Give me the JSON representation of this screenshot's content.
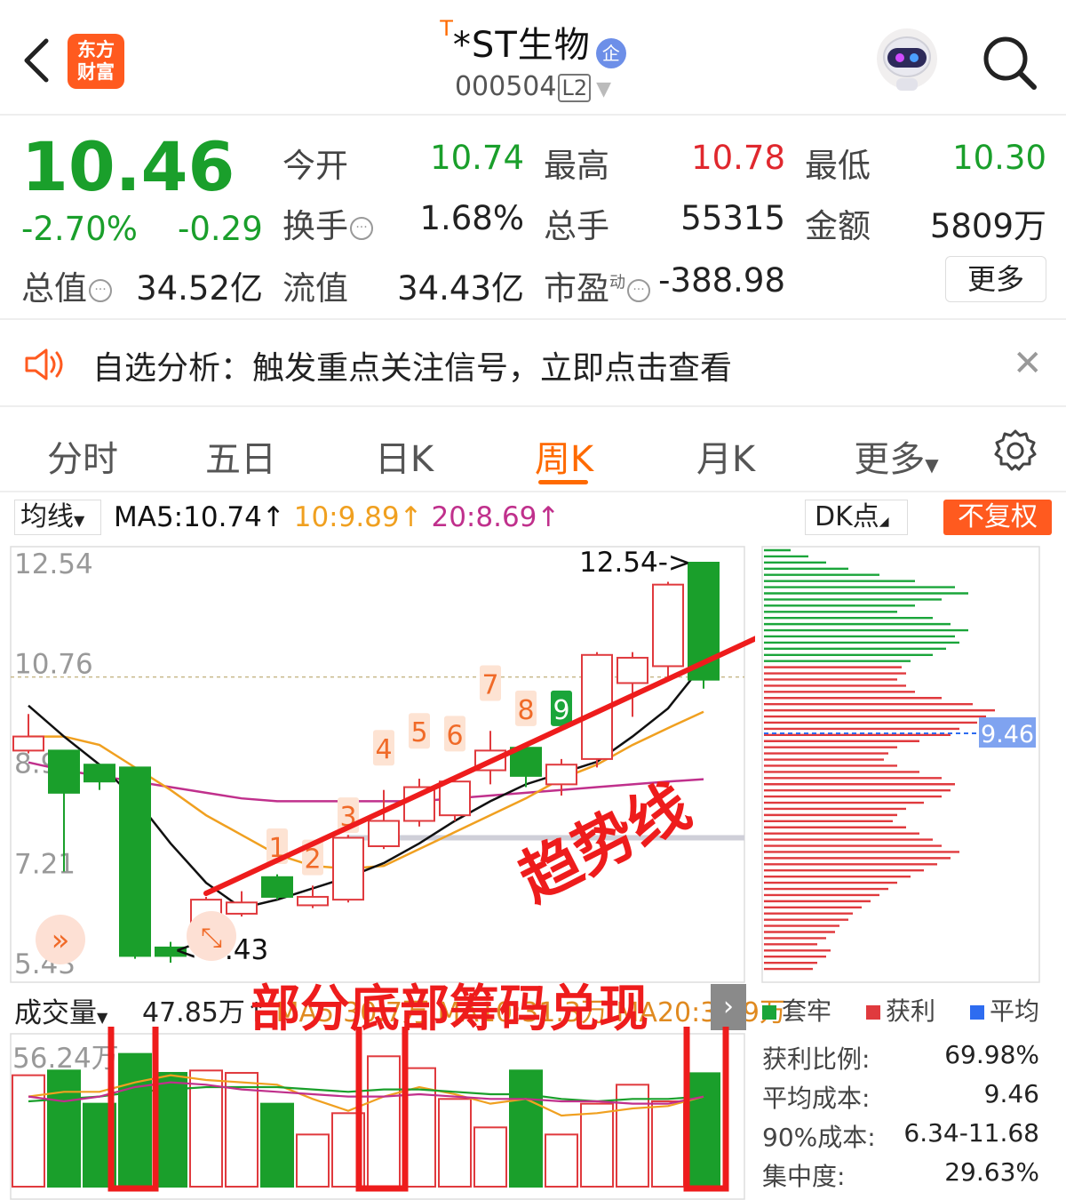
{
  "header": {
    "title": "*ST生物",
    "title_sup": "T",
    "badge": "企",
    "code": "000504",
    "level": "L2",
    "logo_line1": "东方",
    "logo_line2": "财富"
  },
  "quote": {
    "price": "10.46",
    "change_pct": "-2.70%",
    "change": "-0.29",
    "open_label": "今开",
    "open": "10.74",
    "high_label": "最高",
    "high": "10.78",
    "low_label": "最低",
    "low": "10.30",
    "turnover_label": "换手",
    "turnover": "1.68%",
    "volume_label": "总手",
    "volume": "55315",
    "amount_label": "金额",
    "amount": "5809万",
    "mktcap_label": "总值",
    "mktcap": "34.52亿",
    "float_label": "流值",
    "float": "34.43亿",
    "pe_label": "市盈",
    "pe_sup": "动",
    "pe": "-388.98",
    "more_label": "更多"
  },
  "notice": {
    "text": "自选分析：触发重点关注信号，立即点击查看"
  },
  "tabs": [
    "分时",
    "五日",
    "日K",
    "周K",
    "月K",
    "更多"
  ],
  "active_tab": "周K",
  "ma": {
    "selector": "均线",
    "ma5": "MA5:10.74",
    "ma10": "10:9.89",
    "ma20": "20:8.69",
    "colors": {
      "ma5": "#111111",
      "ma10": "#f0a020",
      "ma20": "#c0308c"
    }
  },
  "dk_selector": "DK点",
  "fq_button": "不复权",
  "chart_data": {
    "type": "candlestick",
    "y_ticks": [
      "12.54",
      "10.76",
      "8.99",
      "7.21",
      "5.43"
    ],
    "ylim": [
      5.43,
      12.54
    ],
    "high_marker": "12.54->",
    "low_marker": "<-5.43",
    "candles": [
      {
        "o": 9.2,
        "c": 9.45,
        "h": 9.85,
        "l": 9.15
      },
      {
        "o": 9.2,
        "c": 8.45,
        "h": 9.2,
        "l": 7.05
      },
      {
        "o": 8.95,
        "c": 8.65,
        "h": 8.95,
        "l": 8.5
      },
      {
        "o": 8.9,
        "c": 5.55,
        "h": 8.9,
        "l": 5.5
      },
      {
        "o": 5.7,
        "c": 5.55,
        "h": 5.8,
        "l": 5.43
      },
      {
        "o": 5.7,
        "c": 6.55,
        "h": 6.6,
        "l": 5.6
      },
      {
        "o": 6.3,
        "c": 6.5,
        "h": 6.7,
        "l": 6.25
      },
      {
        "o": 6.95,
        "c": 6.6,
        "h": 7.0,
        "l": 6.55
      },
      {
        "o": 6.45,
        "c": 6.6,
        "h": 6.8,
        "l": 6.4
      },
      {
        "o": 6.55,
        "c": 7.65,
        "h": 7.7,
        "l": 6.5
      },
      {
        "o": 7.5,
        "c": 7.95,
        "h": 8.5,
        "l": 7.45
      },
      {
        "o": 7.95,
        "c": 8.55,
        "h": 8.7,
        "l": 7.85
      },
      {
        "o": 8.05,
        "c": 8.65,
        "h": 8.75,
        "l": 7.95
      },
      {
        "o": 8.85,
        "c": 9.2,
        "h": 9.55,
        "l": 8.6
      },
      {
        "o": 9.25,
        "c": 8.75,
        "h": 9.3,
        "l": 8.55
      },
      {
        "o": 8.6,
        "c": 8.95,
        "h": 9.05,
        "l": 8.4
      },
      {
        "o": 9.05,
        "c": 10.9,
        "h": 10.95,
        "l": 8.9
      },
      {
        "o": 10.4,
        "c": 10.85,
        "h": 10.95,
        "l": 9.8
      },
      {
        "o": 10.7,
        "c": 12.15,
        "h": 12.2,
        "l": 10.5
      },
      {
        "o": 12.54,
        "c": 10.46,
        "h": 12.54,
        "l": 10.3
      }
    ],
    "ma5": [
      10.0,
      9.45,
      8.95,
      8.35,
      7.55,
      6.85,
      6.4,
      6.55,
      6.75,
      6.95,
      7.2,
      7.55,
      7.95,
      8.3,
      8.6,
      8.8,
      9.0,
      9.45,
      9.95,
      10.74
    ],
    "ma10": [
      9.45,
      9.45,
      9.3,
      8.9,
      8.5,
      8.05,
      7.7,
      7.35,
      7.15,
      7.1,
      7.15,
      7.45,
      7.75,
      8.05,
      8.35,
      8.7,
      8.95,
      9.3,
      9.6,
      9.89
    ],
    "ma20": [
      8.99,
      8.85,
      8.75,
      8.65,
      8.55,
      8.45,
      8.35,
      8.3,
      8.3,
      8.3,
      8.3,
      8.3,
      8.35,
      8.4,
      8.45,
      8.5,
      8.55,
      8.6,
      8.65,
      8.69
    ],
    "signals": [
      {
        "label": "1",
        "idx": 7,
        "price": 7.5,
        "color": "orange"
      },
      {
        "label": "2",
        "idx": 8,
        "price": 7.3,
        "color": "orange"
      },
      {
        "label": "3",
        "idx": 9,
        "price": 8.05,
        "color": "orange"
      },
      {
        "label": "4",
        "idx": 10,
        "price": 9.25,
        "color": "orange"
      },
      {
        "label": "5",
        "idx": 11,
        "price": 9.55,
        "color": "orange"
      },
      {
        "label": "6",
        "idx": 12,
        "price": 9.5,
        "color": "orange"
      },
      {
        "label": "7",
        "idx": 13,
        "price": 10.4,
        "color": "orange"
      },
      {
        "label": "8",
        "idx": 14,
        "price": 9.95,
        "color": "orange"
      },
      {
        "label": "9",
        "idx": 15,
        "price": 9.95,
        "color": "green"
      }
    ],
    "trend_label": "趋势线",
    "bottom_label": "部分底部筹码兑现"
  },
  "chips": {
    "avg_label": "9.46",
    "legend": [
      "套牢",
      "获利",
      "平均"
    ],
    "profit_ratio_label": "获利比例:",
    "profit_ratio": "69.98%",
    "avg_cost_label": "平均成本:",
    "avg_cost": "9.46",
    "cost90_label": "90%成本:",
    "cost90": "6.34-11.68",
    "concentration_label": "集中度:",
    "concentration": "29.63%"
  },
  "volume": {
    "selector": "成交量",
    "current": "47.85万",
    "ma_text": "MA5:30.7万  MA10:31.3万  MA20:32.9万",
    "y_tick": "56.24万",
    "values": [
      47,
      49,
      35,
      56,
      48,
      49,
      48,
      35,
      22,
      31,
      55,
      50,
      37,
      25,
      49,
      22,
      35,
      43,
      36,
      47.85
    ]
  }
}
